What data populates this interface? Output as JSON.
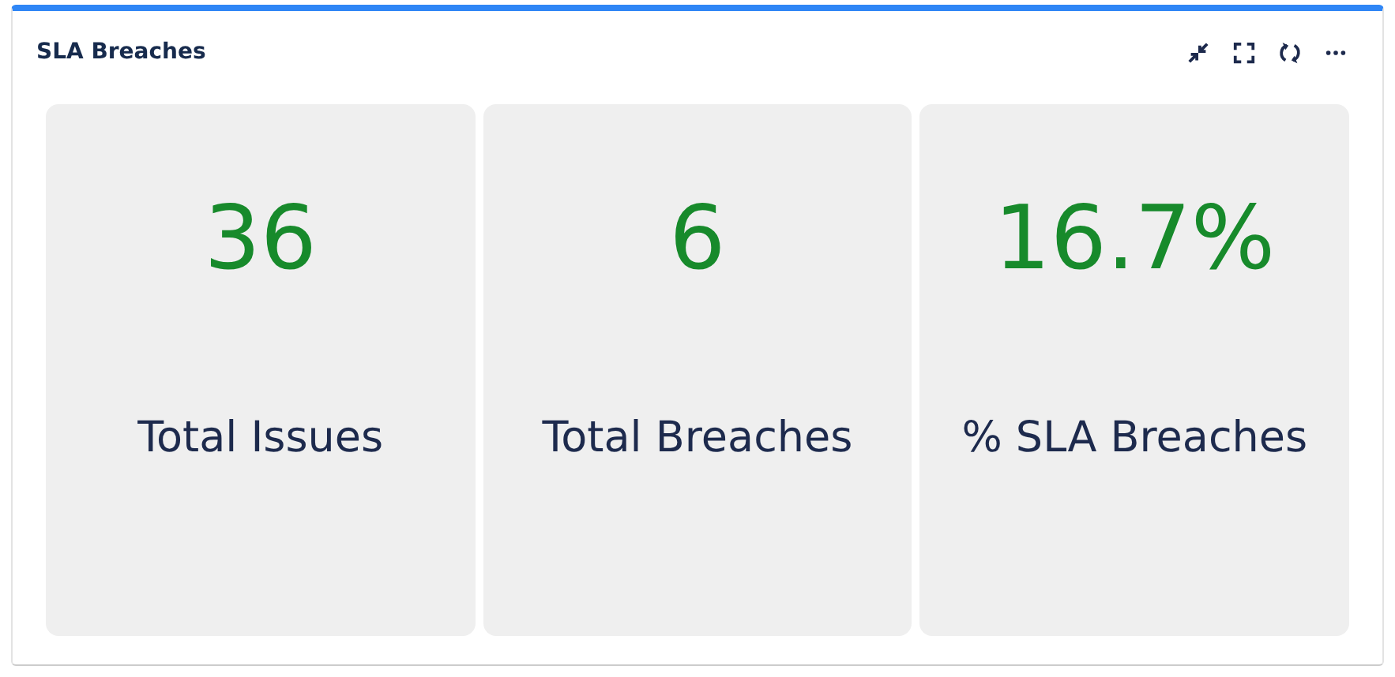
{
  "widget": {
    "title": "SLA Breaches"
  },
  "metrics": [
    {
      "value": "36",
      "label": "Total Issues"
    },
    {
      "value": "6",
      "label": "Total Breaches"
    },
    {
      "value": "16.7%",
      "label": "% SLA Breaches"
    }
  ]
}
